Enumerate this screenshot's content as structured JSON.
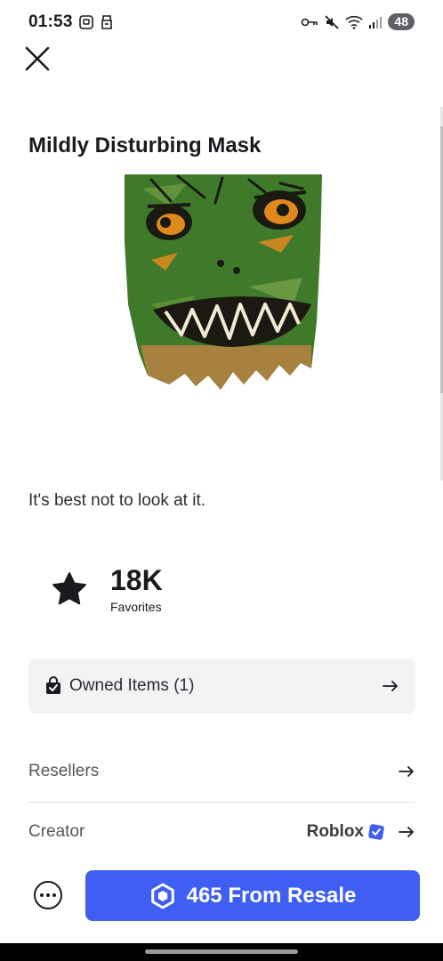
{
  "status_bar": {
    "time": "01:53",
    "battery": "48",
    "left_icons": [
      "screenshot-icon",
      "notification-icon"
    ],
    "right_icons": [
      "vpn-key-icon",
      "mute-icon",
      "wifi-icon",
      "signal-icon"
    ]
  },
  "header": {
    "close_icon": "close-icon"
  },
  "item": {
    "title": "Mildly Disturbing Mask",
    "description": "It's best not to look at it.",
    "image_icon": "mask-image",
    "favorites": {
      "count": "18K",
      "label": "Favorites",
      "icon": "star-icon"
    }
  },
  "owned_items": {
    "label": "Owned Items (1)",
    "icon": "shopping-bag-check-icon"
  },
  "rows": {
    "resellers_label": "Resellers",
    "creator_label": "Creator",
    "creator_name": "Roblox"
  },
  "actions": {
    "buy_label": "465 From Resale",
    "robux_icon": "robux-icon",
    "more_icon": "more-icon"
  },
  "colors": {
    "accent": "#3f5ff2",
    "verified": "#3f5ff2",
    "text": "#1a1b1f",
    "muted": "#55575c",
    "card": "#f2f3f5",
    "mask_green": "#3f7a2a",
    "mask_orange": "#e08a1e"
  }
}
